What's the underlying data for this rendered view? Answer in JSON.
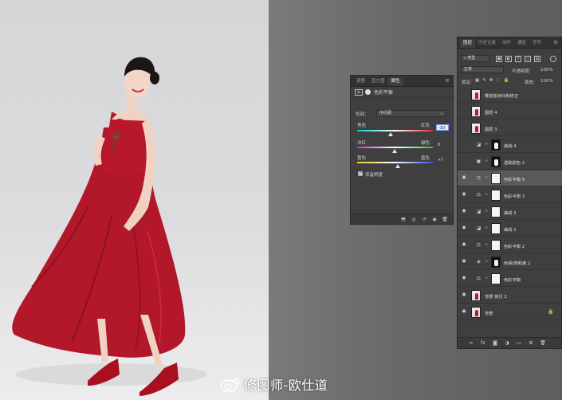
{
  "properties_panel": {
    "tabs": [
      "调整",
      "直方图",
      "属性"
    ],
    "active_tab": 2,
    "adjustment_name": "色彩平衡",
    "tone_label": "色调：",
    "tone_value": "中间调",
    "sliders": [
      {
        "left": "青色",
        "right": "红色",
        "value": "-10",
        "pos": 0.45
      },
      {
        "left": "洋红",
        "right": "绿色",
        "value": "0",
        "pos": 0.5
      },
      {
        "left": "黄色",
        "right": "蓝色",
        "value": "+7",
        "pos": 0.55
      }
    ],
    "preserve_luminosity": "保留明度",
    "bottom_icons": [
      "clip-icon",
      "eye-toggle-icon",
      "reset-icon",
      "visibility-icon",
      "trash-icon"
    ]
  },
  "layers_panel": {
    "tabs": [
      "图层",
      "历史记录",
      "动作",
      "通道",
      "字符"
    ],
    "active_tab": 0,
    "filter_kind": "类型",
    "blend_mode": "正常",
    "opacity_label": "不透明度:",
    "opacity_value": "100%",
    "lock_label": "锁定:",
    "fill_label": "填充:",
    "fill_value": "100%",
    "layers": [
      {
        "name": "橡皮胶液化和修正",
        "visible": false,
        "type": "image",
        "selected": false
      },
      {
        "name": "图层 4",
        "visible": false,
        "type": "image",
        "selected": false
      },
      {
        "name": "图层 3",
        "visible": false,
        "type": "image",
        "selected": false
      },
      {
        "name": "曲线 4",
        "visible": false,
        "type": "curves",
        "selected": false
      },
      {
        "name": "选取颜色 2",
        "visible": false,
        "type": "selective",
        "selected": false
      },
      {
        "name": "色彩平衡 5",
        "visible": true,
        "type": "balance",
        "selected": true
      },
      {
        "name": "色彩平衡 3",
        "visible": true,
        "type": "balance",
        "selected": false
      },
      {
        "name": "曲线 3",
        "visible": true,
        "type": "curves",
        "selected": false
      },
      {
        "name": "曲线 1",
        "visible": true,
        "type": "curves",
        "selected": false
      },
      {
        "name": "色彩平衡 2",
        "visible": true,
        "type": "balance",
        "selected": false
      },
      {
        "name": "色相/饱和度 2",
        "visible": true,
        "type": "huesat",
        "selected": false
      },
      {
        "name": "色彩平衡",
        "visible": true,
        "type": "balance",
        "selected": false
      },
      {
        "name": "背景 拷贝 2",
        "visible": true,
        "type": "image",
        "selected": false
      },
      {
        "name": "背景",
        "visible": true,
        "type": "image",
        "selected": false,
        "locked": true
      }
    ],
    "bottom_icons": [
      "link-icon",
      "fx-icon",
      "mask-icon",
      "adjustment-icon",
      "folder-icon",
      "new-layer-icon",
      "trash-icon"
    ]
  },
  "watermark": {
    "text": "修图师-欧仕道"
  },
  "colors": {
    "dress": "#b8192a",
    "panel": "#3f3f3f",
    "canvas": "#6b6b6b"
  }
}
